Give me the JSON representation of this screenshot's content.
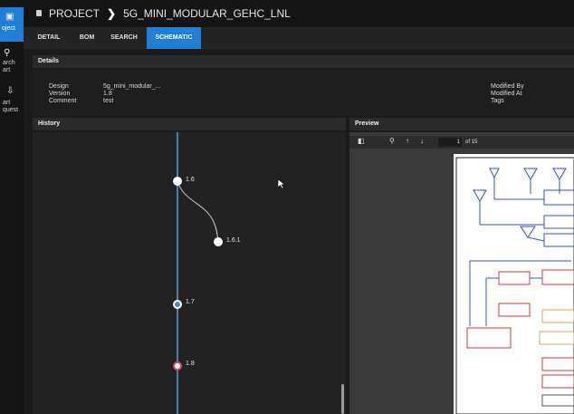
{
  "sidebar": {
    "items": [
      {
        "label": "oject",
        "icon": "project-icon",
        "active": true
      },
      {
        "label": "arch art",
        "icon": "search-icon",
        "active": false
      },
      {
        "label": "art quest",
        "icon": "part-request-icon",
        "active": false
      }
    ]
  },
  "header": {
    "project_label": "PROJECT",
    "project_name": "5G_MINI_MODULAR_GEHC_LNL"
  },
  "tabs": [
    "DETAIL",
    "BOM",
    "SEARCH",
    "SCHEMATIC"
  ],
  "active_tab": "SCHEMATIC",
  "details": {
    "title": "Details",
    "left_labels": [
      "Design",
      "Version",
      "Comment"
    ],
    "left_values": [
      "5g_mini_modular_...",
      "1.8",
      "test"
    ],
    "right_labels": [
      "Modified By",
      "Modified At",
      "Tags"
    ]
  },
  "history": {
    "title": "History",
    "commits": [
      {
        "label": "1.6"
      },
      {
        "label": "1.6.1"
      },
      {
        "label": "1.7"
      },
      {
        "label": "1.8"
      }
    ]
  },
  "preview": {
    "title": "Preview",
    "page_current": "1",
    "page_total_text": "of 15"
  },
  "colors": {
    "accent": "#1f7fd6",
    "branch_line": "#4a7fb0",
    "schematic_blue": "#3a4fd0",
    "schematic_red": "#d03a3a"
  }
}
